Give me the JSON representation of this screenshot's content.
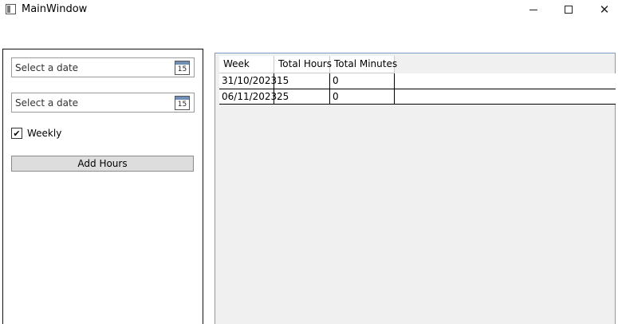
{
  "window": {
    "title": "MainWindow",
    "caption_buttons": {
      "minimize_icon": "minimize-icon",
      "maximize_icon": "maximize-icon",
      "close_icon": "close-icon",
      "close_glyph": "✕"
    }
  },
  "form": {
    "start_date": {
      "placeholder": "Select a date",
      "calendar_day": "15"
    },
    "end_date": {
      "placeholder": "Select a date",
      "calendar_day": "15"
    },
    "weekly": {
      "label": "Weekly",
      "checked": true,
      "check_glyph": "✔"
    },
    "add_button_label": "Add Hours"
  },
  "grid": {
    "columns": [
      "Week",
      "Total Hours",
      "Total Minutes"
    ],
    "rows": [
      {
        "week": "31/10/2023",
        "total_hours": "15",
        "total_minutes": "0"
      },
      {
        "week": "06/11/2023",
        "total_hours": "25",
        "total_minutes": "0"
      }
    ]
  },
  "colors": {
    "grid_border": "#7a9cc6",
    "grid_background": "#f0f0f0",
    "button_background": "#dddddd"
  }
}
